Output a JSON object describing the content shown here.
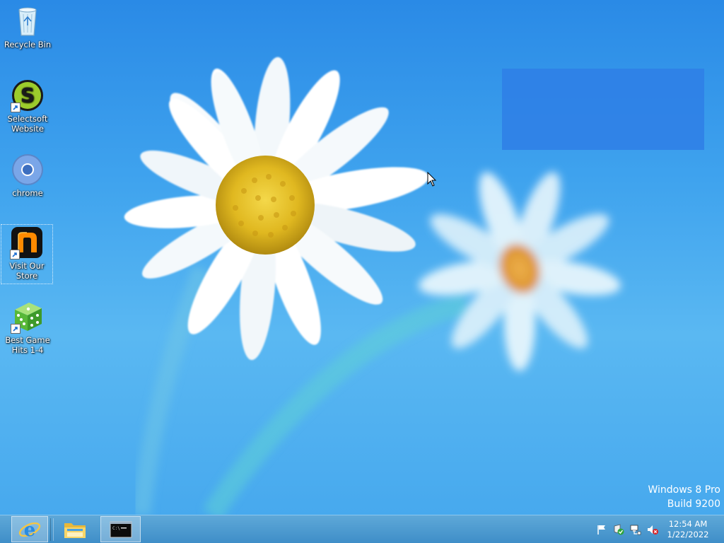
{
  "desktop": {
    "icons": [
      {
        "label": "Recycle Bin",
        "icon": "recycle-bin-icon",
        "shortcut": false,
        "selected": false
      },
      {
        "label": "Selectsoft Website",
        "icon": "selectsoft-logo-icon",
        "shortcut": true,
        "selected": false
      },
      {
        "label": "chrome",
        "icon": "chrome-icon",
        "shortcut": false,
        "selected": false
      },
      {
        "label": "Visit Our Store",
        "icon": "store-logo-icon",
        "shortcut": true,
        "selected": true
      },
      {
        "label": "Best Game Hits 1-4",
        "icon": "dice-icon",
        "shortcut": true,
        "selected": false
      }
    ],
    "watermark": {
      "line1": "Windows 8 Pro",
      "line2": "Build 9200"
    }
  },
  "taskbar": {
    "pinned": [
      {
        "name": "internet-explorer",
        "icon": "internet-explorer-icon",
        "active": true
      },
      {
        "name": "file-explorer",
        "icon": "folder-icon",
        "active": false
      },
      {
        "name": "command-prompt",
        "icon": "command-prompt-icon",
        "active": true
      }
    ],
    "tray": [
      {
        "name": "action-center",
        "icon": "flag-icon"
      },
      {
        "name": "security",
        "icon": "shield-check-icon"
      },
      {
        "name": "network",
        "icon": "network-icon"
      },
      {
        "name": "volume",
        "icon": "speaker-muted-icon"
      }
    ],
    "clock": {
      "time": "12:54 AM",
      "date": "1/22/2022"
    }
  },
  "colors": {
    "wallpaper_top": "#2a8ae6",
    "wallpaper_bottom": "#47a9ee",
    "taskbar": "#4a98d0",
    "overlay": "#2f7fe6"
  }
}
